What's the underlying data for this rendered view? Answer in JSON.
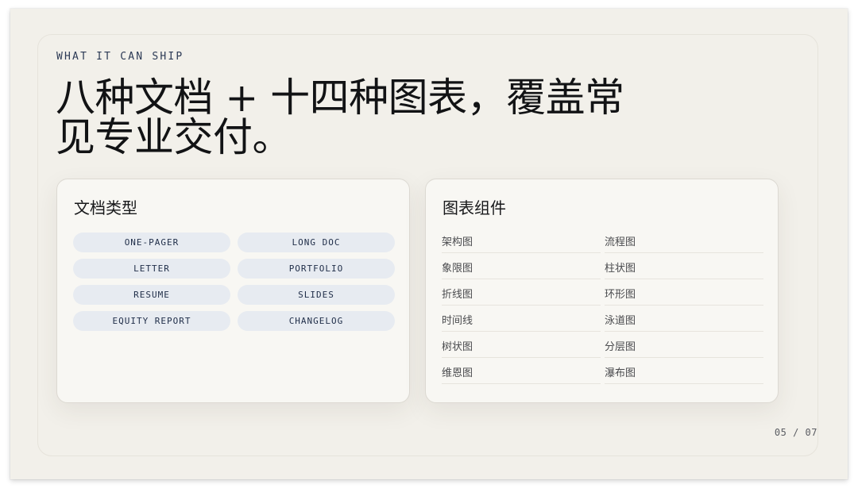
{
  "slide": {
    "eyebrow": "WHAT IT CAN SHIP",
    "headline": "八种文档 + 十四种图表，覆盖常见专业交付。",
    "page_indicator": "05 / 07"
  },
  "doc_types": {
    "title": "文档类型",
    "items": [
      "ONE-PAGER",
      "LONG DOC",
      "LETTER",
      "PORTFOLIO",
      "RESUME",
      "SLIDES",
      "EQUITY REPORT",
      "CHANGELOG"
    ]
  },
  "chart_components": {
    "title": "图表组件",
    "items": [
      "架构图",
      "流程图",
      "象限图",
      "柱状图",
      "折线图",
      "环形图",
      "时间线",
      "泳道图",
      "树状图",
      "分层图",
      "维恩图",
      "瀑布图"
    ]
  },
  "colors": {
    "slide_background": "#f2f0ea",
    "card_background": "#f8f7f3",
    "pill_background": "#e7ebf1",
    "accent_text": "#2c3a55"
  }
}
